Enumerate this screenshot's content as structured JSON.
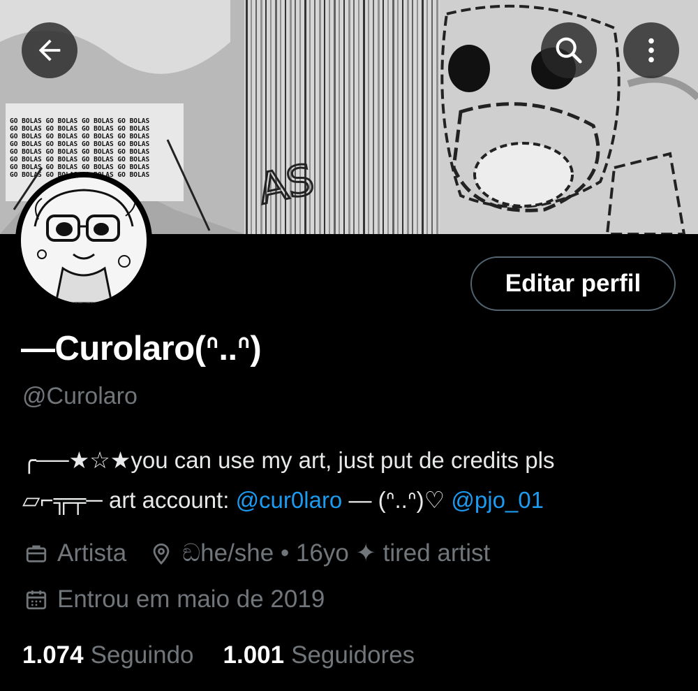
{
  "profile": {
    "display_name": "—Curolaro(ᐢ..ᐢ)",
    "handle": "@Curolaro",
    "edit_label": "Editar perfil"
  },
  "bio": {
    "line1": "╭──★☆★you can use my art, just put de credits pls",
    "line2_prefix": "▱⌐╦╤─ art account: ",
    "link1": "@cur0laro",
    "line2_middle": " — (ᐢ..ᐢ)♡ ",
    "link2": "@pjo_01"
  },
  "meta": {
    "profession": "Artista",
    "location": "ඞhe/she • 16yo ✦ tired artist",
    "joined": "Entrou em maio de 2019"
  },
  "stats": {
    "following_count": "1.074",
    "following_label": "Seguindo",
    "followers_count": "1.001",
    "followers_label": "Seguidores"
  },
  "banner": {
    "text_rows": [
      "GO BOLAS GO BOLAS GO BOLAS GO BOLAS",
      "GO BOLAS GO BOLAS GO BOLAS GO BOLAS",
      "GO BOLAS GO BOLAS GO BOLAS GO BOLAS",
      "GO BOLAS GO BOLAS GO BOLAS GO BOLAS",
      "GO BOLAS GO BOLAS GO BOLAS GO BOLAS",
      "GO BOLAS GO BOLAS GO BOLAS GO BOLAS",
      "GO BOLAS GO BOLAS GO BOLAS GO BOLAS",
      "GO BOLAS GO BOLAS GO BOLAS GO BOLAS"
    ]
  },
  "colors": {
    "background": "#000000",
    "text_primary": "#e7e9ea",
    "text_secondary": "#71767b",
    "link": "#1d9bf0",
    "button_border": "#536471"
  },
  "icons": {
    "back": "arrow-left-icon",
    "search": "search-icon",
    "more": "more-vertical-icon",
    "profession": "briefcase-icon",
    "location": "location-pin-icon",
    "joined": "calendar-icon"
  }
}
